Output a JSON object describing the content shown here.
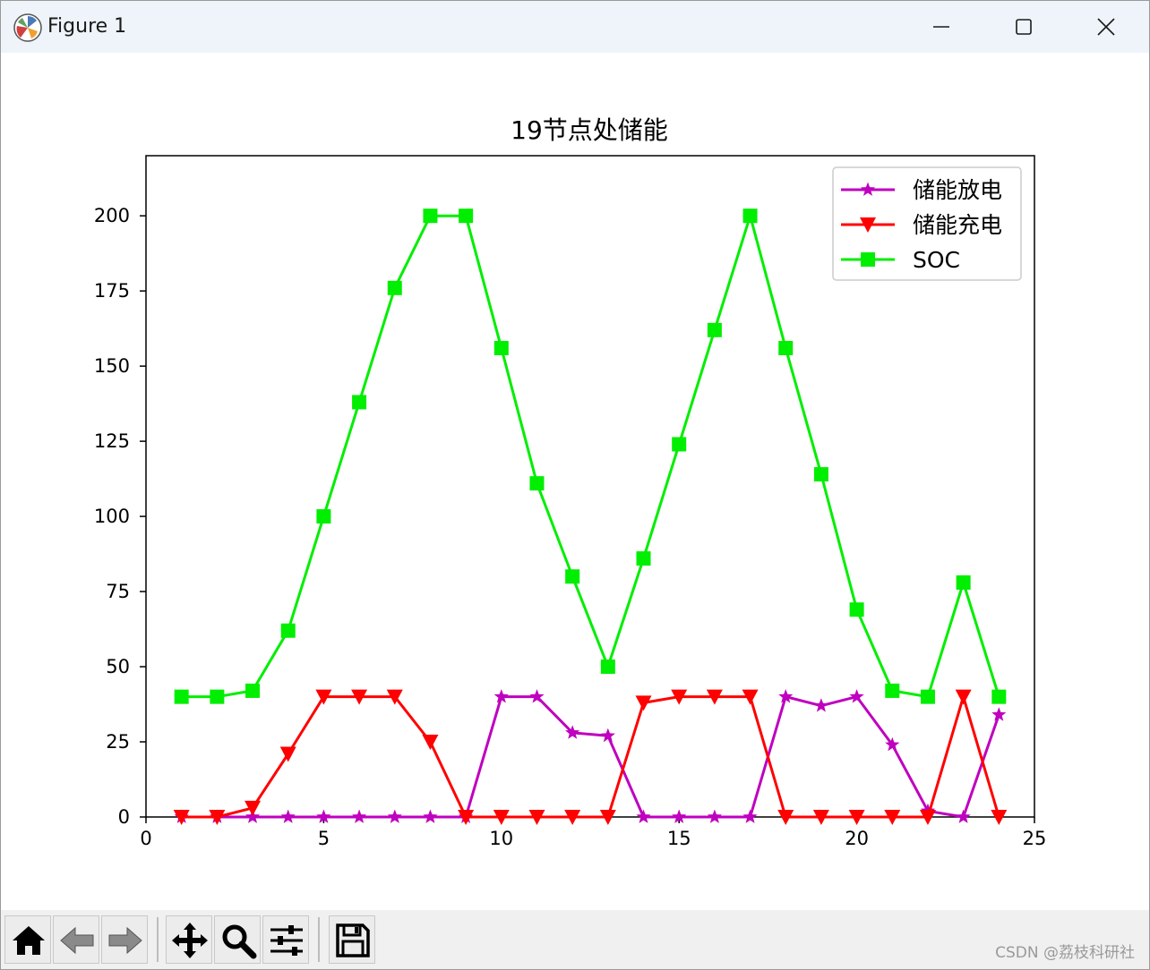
{
  "window": {
    "title": "Figure 1",
    "controls": [
      "minimize",
      "maximize",
      "close"
    ]
  },
  "toolbar": {
    "buttons": [
      "home-icon",
      "back-icon",
      "forward-icon",
      "pan-icon",
      "zoom-icon",
      "configure-subplots-icon",
      "save-icon"
    ]
  },
  "watermark": "CSDN @荔枝科研社",
  "colors": {
    "discharge": "#bf00bf",
    "charge": "#ff0000",
    "soc": "#00ee00",
    "titlebar": "#eef4f9",
    "toolbar": "#f0f0f0"
  },
  "chart_data": {
    "type": "line",
    "title": "19节点处储能",
    "xlabel": "",
    "ylabel": "",
    "xlim": [
      0,
      25
    ],
    "ylim": [
      0,
      220
    ],
    "xticks": [
      0,
      5,
      10,
      15,
      20,
      25
    ],
    "yticks": [
      0,
      25,
      50,
      75,
      100,
      125,
      150,
      175,
      200
    ],
    "grid": false,
    "legend_position": "top-right",
    "x": [
      1,
      2,
      3,
      4,
      5,
      6,
      7,
      8,
      9,
      10,
      11,
      12,
      13,
      14,
      15,
      16,
      17,
      18,
      19,
      20,
      21,
      22,
      23,
      24
    ],
    "series": [
      {
        "name": "储能放电",
        "color": "#bf00bf",
        "marker": "star",
        "values": [
          0,
          0,
          0,
          0,
          0,
          0,
          0,
          0,
          0,
          40,
          40,
          28,
          27,
          0,
          0,
          0,
          0,
          40,
          37,
          40,
          24,
          2,
          0,
          34
        ]
      },
      {
        "name": "储能充电",
        "color": "#ff0000",
        "marker": "triangle-down",
        "values": [
          0,
          0,
          3,
          21,
          40,
          40,
          40,
          25,
          0,
          0,
          0,
          0,
          0,
          38,
          40,
          40,
          40,
          0,
          0,
          0,
          0,
          0,
          40,
          0
        ]
      },
      {
        "name": "SOC",
        "color": "#00ee00",
        "marker": "square",
        "values": [
          40,
          40,
          42,
          62,
          100,
          138,
          176,
          200,
          200,
          156,
          111,
          80,
          50,
          86,
          124,
          162,
          200,
          156,
          114,
          69,
          42,
          40,
          78,
          40
        ]
      }
    ]
  }
}
